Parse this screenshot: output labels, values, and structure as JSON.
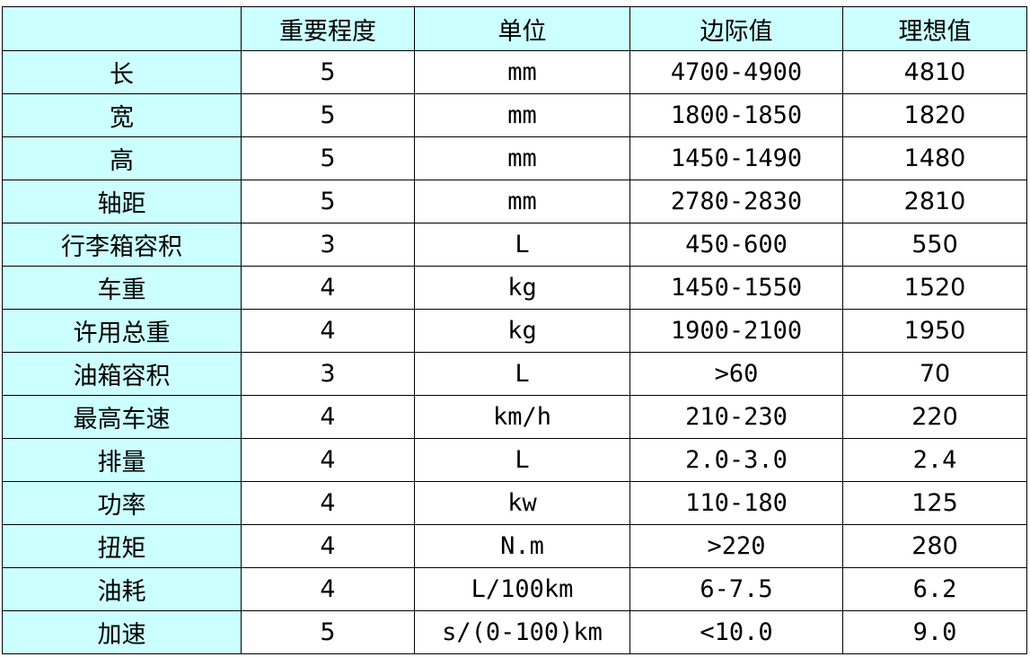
{
  "table": {
    "header": [
      "",
      "重要程度",
      "单位",
      "边际值",
      "理想值"
    ],
    "rows": [
      {
        "name": "长",
        "importance": "5",
        "unit": "mm",
        "range": "4700-4900",
        "ideal": "4810"
      },
      {
        "name": "宽",
        "importance": "5",
        "unit": "mm",
        "range": "1800-1850",
        "ideal": "1820"
      },
      {
        "name": "高",
        "importance": "5",
        "unit": "mm",
        "range": "1450-1490",
        "ideal": "1480"
      },
      {
        "name": "轴距",
        "importance": "5",
        "unit": "mm",
        "range": "2780-2830",
        "ideal": "2810"
      },
      {
        "name": "行李箱容积",
        "importance": "3",
        "unit": "L",
        "range": "450-600",
        "ideal": "550"
      },
      {
        "name": "车重",
        "importance": "4",
        "unit": "kg",
        "range": "1450-1550",
        "ideal": "1520"
      },
      {
        "name": "许用总重",
        "importance": "4",
        "unit": "kg",
        "range": "1900-2100",
        "ideal": "1950"
      },
      {
        "name": "油箱容积",
        "importance": "3",
        "unit": "L",
        "range": ">60",
        "ideal": "70"
      },
      {
        "name": "最高车速",
        "importance": "4",
        "unit": "km/h",
        "range": "210-230",
        "ideal": "220"
      },
      {
        "name": "排量",
        "importance": "4",
        "unit": "L",
        "range": "2.0-3.0",
        "ideal": "2.4"
      },
      {
        "name": "功率",
        "importance": "4",
        "unit": "kw",
        "range": "110-180",
        "ideal": "125"
      },
      {
        "name": "扭矩",
        "importance": "4",
        "unit": "N.m",
        "range": ">220",
        "ideal": "280"
      },
      {
        "name": "油耗",
        "importance": "4",
        "unit": "L/100km",
        "range": "6-7.5",
        "ideal": "6.2"
      },
      {
        "name": "加速",
        "importance": "5",
        "unit": "s/(0-100)km",
        "range": "<10.0",
        "ideal": "9.0"
      }
    ]
  },
  "colors": {
    "header_fill": "#ccffff",
    "border": "#000000",
    "text": "#000000"
  }
}
